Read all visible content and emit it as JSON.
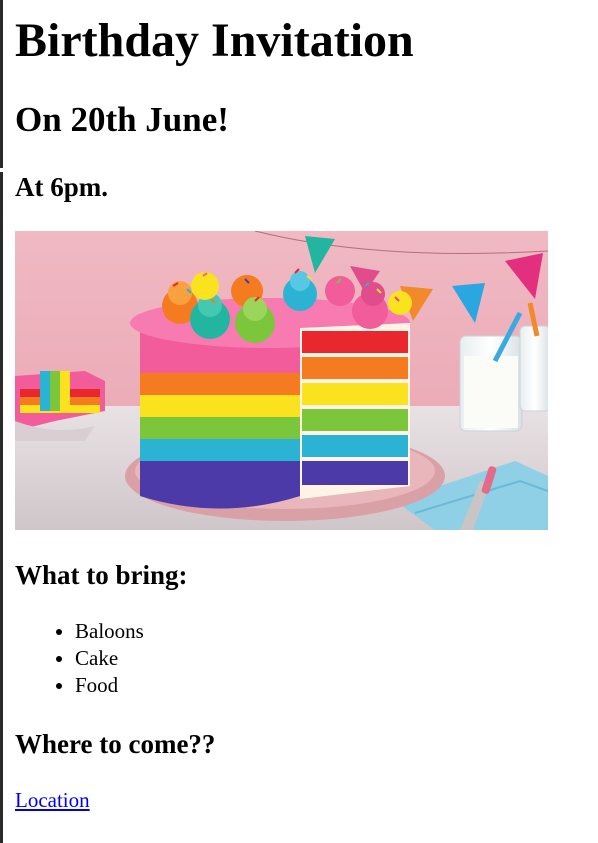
{
  "page": {
    "title": "Birthday Invitation",
    "date_heading": "On 20th June!",
    "time_heading": "At 6pm.",
    "bring_heading": "What to bring:",
    "bring_items": [
      "Baloons",
      "Cake",
      "Food"
    ],
    "where_heading": "Where to come??",
    "location_link": "Location"
  },
  "image": {
    "subject": "rainbow-layer-cake",
    "colors": {
      "background": "#efb6c0",
      "frosting": "#f25c9a",
      "layer_red": "#e8282e",
      "layer_orange": "#f57b20",
      "layer_yellow": "#fbe21e",
      "layer_green": "#7cc63c",
      "layer_blue": "#2bb3d4",
      "layer_purple": "#4b3aa7"
    }
  },
  "colors": {
    "link": "#0000ee",
    "text": "#000000",
    "left_bar": "#2a2a2a"
  }
}
